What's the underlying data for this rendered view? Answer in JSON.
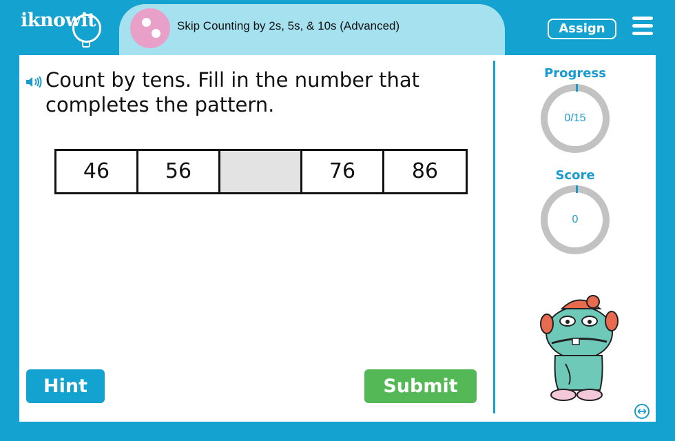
{
  "brand": {
    "logo_text": "iknowit"
  },
  "lesson": {
    "title": "Skip Counting by 2s, 5s, & 10s (Advanced)"
  },
  "header": {
    "assign_label": "Assign"
  },
  "question": {
    "prompt": "Count by tens. Fill in the number that completes the pattern."
  },
  "pattern": {
    "cells": [
      "46",
      "56",
      "",
      "76",
      "86"
    ]
  },
  "buttons": {
    "hint_label": "Hint",
    "submit_label": "Submit"
  },
  "sidebar": {
    "progress_label": "Progress",
    "progress_value": "0/15",
    "score_label": "Score",
    "score_value": "0"
  },
  "colors": {
    "brand_blue": "#14a3d0",
    "submit_green": "#55b856",
    "topic_pink": "#e8a0c9",
    "title_bar": "#a6e1ef"
  },
  "icons": [
    "speaker-icon",
    "menu-icon",
    "expand-icon",
    "topic-icon"
  ]
}
